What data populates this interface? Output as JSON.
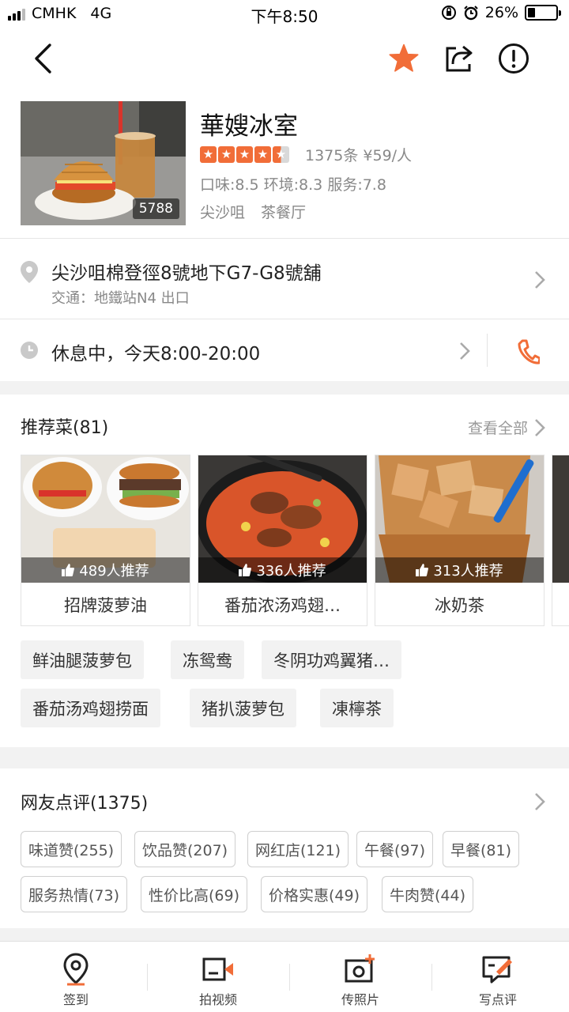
{
  "status_bar": {
    "carrier": "CMHK",
    "network": "4G",
    "time": "下午8:50",
    "battery": "26%",
    "battery_level": 0.26
  },
  "nav": {
    "back_icon": "chevron-left-icon",
    "favorite_icon": "star-icon",
    "share_icon": "share-icon",
    "report_icon": "alert-circle-icon",
    "favorite_color": "#f16d38"
  },
  "shop": {
    "name": "華嫂冰室",
    "photo_count": "5788",
    "rating_stars": 4.5,
    "reviews_price": "1375条  ¥59/人",
    "scores": "口味:8.5 环境:8.3 服务:7.8",
    "district": "尖沙咀",
    "category": "茶餐厅"
  },
  "address": {
    "line": "尖沙咀棉登徑8號地下G7-G8號舖",
    "transit": "交通：地鐵站N4 出口"
  },
  "hours": {
    "text": "休息中，今天8:00-20:00"
  },
  "recommended": {
    "title": "推荐菜(81)",
    "see_all": "查看全部",
    "dishes": [
      {
        "name": "招牌菠萝油",
        "recommend": "489人推荐"
      },
      {
        "name": "番茄浓汤鸡翅…",
        "recommend": "336人推荐"
      },
      {
        "name": "冰奶茶",
        "recommend": "313人推荐"
      }
    ],
    "tags": [
      "鲜油腿菠萝包",
      "冻鸳鸯",
      "冬阴功鸡翼猪…",
      "番茄汤鸡翅捞面",
      "猪扒菠萝包",
      "凍檸茶"
    ]
  },
  "reviews": {
    "title": "网友点评(1375)",
    "tags": [
      "味道赞(255)",
      "饮品赞(207)",
      "网红店(121)",
      "午餐(97)",
      "早餐(81)",
      "服务热情(73)",
      "性价比高(69)",
      "价格实惠(49)",
      "牛肉赞(44)"
    ]
  },
  "bottom_bar": {
    "items": [
      {
        "label": "签到",
        "icon": "location-pin-icon"
      },
      {
        "label": "拍视频",
        "icon": "video-camera-icon"
      },
      {
        "label": "传照片",
        "icon": "add-photo-icon"
      },
      {
        "label": "写点评",
        "icon": "write-review-icon"
      }
    ]
  },
  "colors": {
    "accent": "#f16d38",
    "text_muted": "#888888"
  }
}
